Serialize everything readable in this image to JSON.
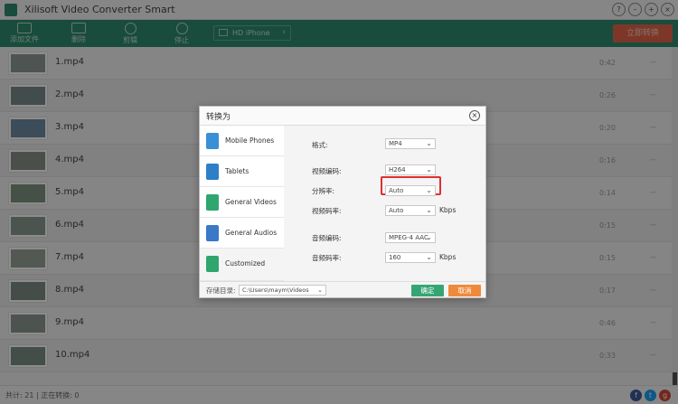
{
  "app": {
    "title": "Xilisoft Video Converter Smart"
  },
  "window_controls": [
    "?",
    "–",
    "+",
    "×"
  ],
  "toolbar": {
    "items": [
      {
        "label": "添加文件",
        "icon": "film-add-icon"
      },
      {
        "label": "删除",
        "icon": "delete-icon"
      },
      {
        "label": "剪辑",
        "icon": "clip-icon"
      },
      {
        "label": "停止",
        "icon": "stop-icon"
      }
    ],
    "profile": "HD iPhone",
    "convert_label": "立即转换"
  },
  "files": [
    {
      "name": "1.mp4",
      "duration": "0:42",
      "status": "--"
    },
    {
      "name": "2.mp4",
      "duration": "0:26",
      "status": "--"
    },
    {
      "name": "3.mp4",
      "duration": "0:20",
      "status": "--"
    },
    {
      "name": "4.mp4",
      "duration": "0:16",
      "status": "--"
    },
    {
      "name": "5.mp4",
      "duration": "0:14",
      "status": "--"
    },
    {
      "name": "6.mp4",
      "duration": "0:15",
      "status": "--"
    },
    {
      "name": "7.mp4",
      "duration": "0:15",
      "status": "--"
    },
    {
      "name": "8.mp4",
      "duration": "0:17",
      "status": "--"
    },
    {
      "name": "9.mp4",
      "duration": "0:46",
      "status": "--"
    },
    {
      "name": "10.mp4",
      "duration": "0:33",
      "status": "--"
    }
  ],
  "statusbar": {
    "text": "共计: 21  | 正在转换: 0"
  },
  "dialog": {
    "title": "转换为",
    "categories": [
      {
        "label": "Mobile Phones",
        "icon": "phone-icon",
        "color": "#3a8fd6"
      },
      {
        "label": "Tablets",
        "icon": "tablet-icon",
        "color": "#2f7fc8"
      },
      {
        "label": "General Videos",
        "icon": "video-icon",
        "color": "#2ea66e"
      },
      {
        "label": "General Audios",
        "icon": "music-icon",
        "color": "#3a78c8"
      },
      {
        "label": "Customized",
        "icon": "edit-icon",
        "color": "#2ea66e"
      }
    ],
    "settings": {
      "format": {
        "label": "格式:",
        "value": "MP4"
      },
      "video_codec": {
        "label": "视频编码:",
        "value": "H264"
      },
      "resolution": {
        "label": "分辨率:",
        "value": "Auto"
      },
      "video_bitrate": {
        "label": "视频码率:",
        "value": "Auto",
        "unit": "Kbps"
      },
      "audio_codec": {
        "label": "音频编码:",
        "value": "MPEG-4 AAC"
      },
      "audio_bitrate": {
        "label": "音频码率:",
        "value": "160",
        "unit": "Kbps"
      }
    },
    "footer": {
      "dir_label": "存储目录:",
      "dir_value": "C:\\Users\\maym\\Videos",
      "ok": "确定",
      "cancel": "取消"
    }
  }
}
